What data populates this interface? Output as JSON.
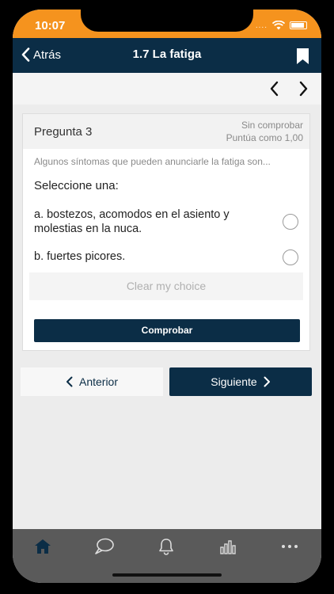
{
  "status": {
    "time": "10:07",
    "signal_dots": "....",
    "wifi": "wifi-icon",
    "battery": "battery-icon"
  },
  "navbar": {
    "back_label": "Atrás",
    "title": "1.7 La fatiga",
    "bookmark": "bookmark-icon"
  },
  "question": {
    "title": "Pregunta 3",
    "status": "Sin comprobar",
    "score": "Puntúa como 1,00",
    "text": "Algunos síntomas que pueden anunciarle la fatiga son...",
    "select_prompt": "Seleccione una:",
    "options": [
      {
        "label": "a. bostezos, acomodos en el asiento y molestias en la nuca.",
        "selected": false
      },
      {
        "label": "b. fuertes picores.",
        "selected": false
      }
    ],
    "clear_label": "Clear my choice",
    "check_label": "Comprobar"
  },
  "navigation": {
    "prev_label": "Anterior",
    "next_label": "Siguiente"
  },
  "tabbar": {
    "items": [
      "home-icon",
      "chat-icon",
      "bell-icon",
      "chart-icon",
      "more-icon"
    ],
    "active": "home-icon"
  },
  "colors": {
    "accent": "#f5931e",
    "primary": "#0b2d46",
    "tabbar": "#5a5a5a",
    "active_tab": "#0b2d46",
    "inactive_tab": "#dcdcdc"
  }
}
